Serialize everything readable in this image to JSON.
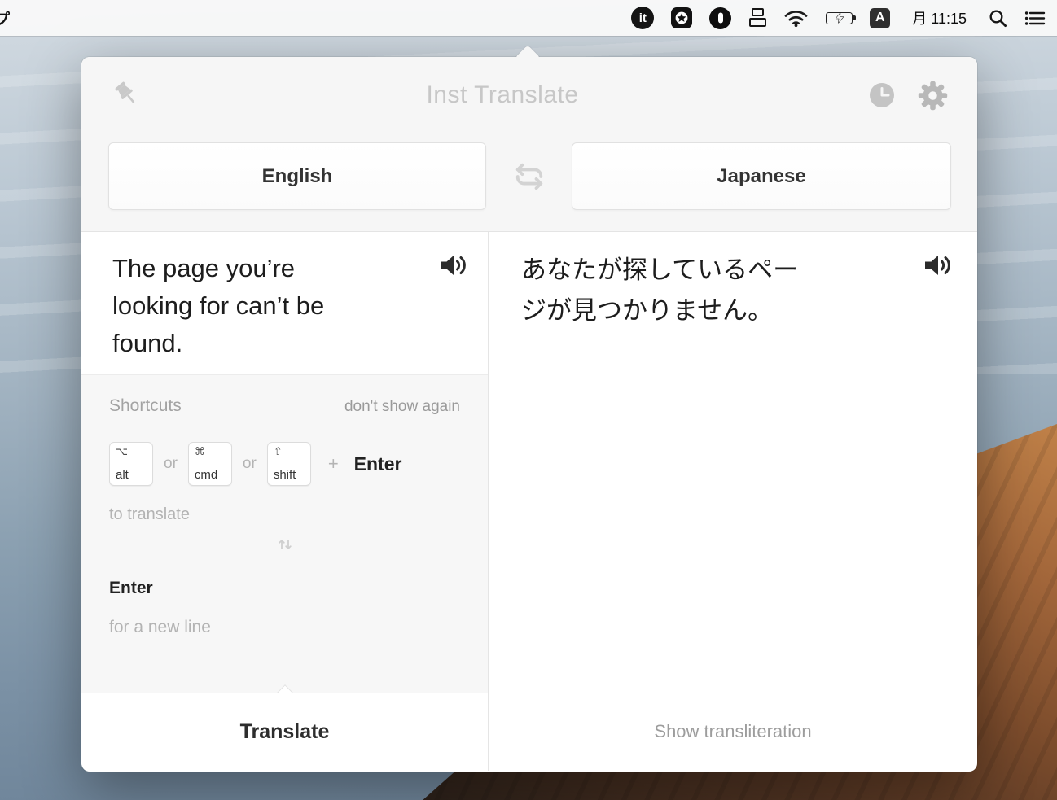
{
  "menu_bar": {
    "app_menu_partial": "プ",
    "translate_app_glyph": "it",
    "input_source": "A",
    "clock": "月 11:15"
  },
  "popover": {
    "title": "Inst Translate",
    "source_language": "English",
    "target_language": "Japanese",
    "source_text": "The page you’re looking for can’t be found.",
    "translated_text": "あなたが探しているページが見つかりません。",
    "shortcuts": {
      "heading": "Shortcuts",
      "dismiss_label": "don't show again",
      "or_label": "or",
      "plus_label": "+",
      "enter_label": "Enter",
      "keys": [
        {
          "glyph": "⌥",
          "label": "alt"
        },
        {
          "glyph": "⌘",
          "label": "cmd"
        },
        {
          "glyph": "⇧",
          "label": "shift"
        }
      ],
      "translate_hint": "to translate",
      "newline_key": "Enter",
      "newline_hint": "for a new line"
    },
    "translate_button": "Translate",
    "transliteration_link": "Show transliteration"
  }
}
